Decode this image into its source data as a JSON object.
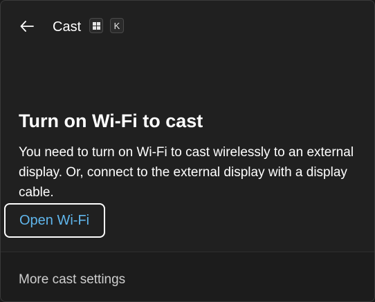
{
  "header": {
    "back_icon": "arrow-left-icon",
    "title": "Cast",
    "shortcut": {
      "win_key_icon": "windows-key-icon",
      "key": "K"
    }
  },
  "content": {
    "heading": "Turn on Wi-Fi to cast",
    "description": "You need to turn on Wi-Fi to cast wirelessly to an external display. Or, connect to the external display with a display cable.",
    "open_wifi_label": "Open Wi-Fi"
  },
  "footer": {
    "more_settings_label": "More cast settings"
  },
  "colors": {
    "background": "#202020",
    "link": "#60b6ec",
    "text": "#ffffff",
    "footer_bg": "#1c1c1c"
  }
}
